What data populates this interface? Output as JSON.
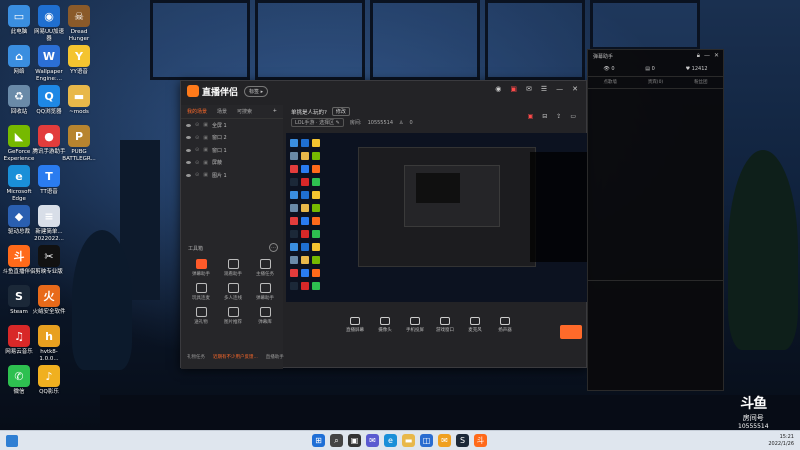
{
  "desktop_icons": [
    {
      "label": "此电脑",
      "glyph": "▭",
      "color": "#3a8ee0"
    },
    {
      "label": "网易UU加速器",
      "glyph": "◉",
      "color": "#1f6fd0"
    },
    {
      "label": "Dread Hunger",
      "glyph": "☠",
      "color": "#8a5a2a"
    },
    {
      "label": "网络",
      "glyph": "⌂",
      "color": "#3a8ee0"
    },
    {
      "label": "Wallpaper Engine:...",
      "glyph": "W",
      "color": "#2b6fd6"
    },
    {
      "label": "YY语音",
      "glyph": "Y",
      "color": "#f4c430"
    },
    {
      "label": "回收站",
      "glyph": "♻",
      "color": "#6a8aa8"
    },
    {
      "label": "QQ浏览器",
      "glyph": "Q",
      "color": "#1e88e5"
    },
    {
      "label": "~mods",
      "glyph": "▬",
      "color": "#e8b84a"
    },
    {
      "label": "GeForce Experience",
      "glyph": "◣",
      "color": "#76b900"
    },
    {
      "label": "腾讯手游助手",
      "glyph": "●",
      "color": "#e23c3c"
    },
    {
      "label": "PUBG BATTLEGR...",
      "glyph": "P",
      "color": "#b7842f"
    },
    {
      "label": "Microsoft Edge",
      "glyph": "e",
      "color": "#1a8fd8"
    },
    {
      "label": "TT语音",
      "glyph": "T",
      "color": "#2a7cf0"
    },
    {
      "label": "驱动总裁",
      "glyph": "◆",
      "color": "#2a5fb0"
    },
    {
      "label": "新建简单... 2022022...",
      "glyph": "≡",
      "color": "#d8dee8"
    },
    {
      "label": "斗鱼直播伴侣",
      "glyph": "斗",
      "color": "#ff6a1a"
    },
    {
      "label": "剪映专业版",
      "glyph": "✂",
      "color": "#111111"
    },
    {
      "label": "Steam",
      "glyph": "S",
      "color": "#1b2838"
    },
    {
      "label": "火绒安全软件",
      "glyph": "火",
      "color": "#e86a1a"
    },
    {
      "label": "网易云音乐",
      "glyph": "♫",
      "color": "#d82828"
    },
    {
      "label": "hvtk8-1.0.0...",
      "glyph": "h",
      "color": "#e8a020"
    },
    {
      "label": "微信",
      "glyph": "✆",
      "color": "#2ec050"
    },
    {
      "label": "QQ影乐",
      "glyph": "♪",
      "color": "#f0b020"
    }
  ],
  "app": {
    "title": "直播伴侣",
    "tag": "标签 ▸",
    "scene_tabs": [
      "我的场景",
      "场景",
      "可搜索"
    ],
    "scenes": [
      "全屏 1",
      "窗口 2",
      "窗口 1",
      "屏蔽",
      "图片 1"
    ],
    "tools_title": "工具箱",
    "tools": [
      {
        "label": "弹幕助手",
        "highlight": true
      },
      {
        "label": "观看助手",
        "highlight": false
      },
      {
        "label": "主播任务",
        "highlight": false
      },
      {
        "label": "玩具连麦",
        "highlight": false
      },
      {
        "label": "多人连线",
        "highlight": false
      },
      {
        "label": "弹幕助手",
        "highlight": false
      },
      {
        "label": "送礼物",
        "highlight": false
      },
      {
        "label": "图片推荐",
        "highlight": false
      },
      {
        "label": "弹幕库",
        "highlight": false
      }
    ],
    "room_title": "单挑是人玩的?",
    "room_btn": "修改",
    "room_category": "LOL手游 · 选择区 ✎",
    "room_id_label": "房间:",
    "room_id": "10555514",
    "room_fans": "0",
    "bottom_tools": [
      "直播屏幕",
      "摄像头",
      "手机投屏",
      "游戏窗口",
      "麦克风",
      "扬声器"
    ],
    "status_left": "礼物任务",
    "status_warn": "近期有不少用户反馈...",
    "status_right": "直播助手"
  },
  "danmaku": {
    "title": "弹幕助手",
    "stat_left": "0",
    "stat_mid": "0",
    "stat_right": "12412",
    "tabs": [
      "点歌墙",
      "贵宾(0)",
      "粉丝团"
    ]
  },
  "watermark": {
    "logo": "斗鱼",
    "sub": "房间号",
    "num": "10555514"
  },
  "taskbar": {
    "time": "15:21",
    "date": "2022/1/26"
  }
}
